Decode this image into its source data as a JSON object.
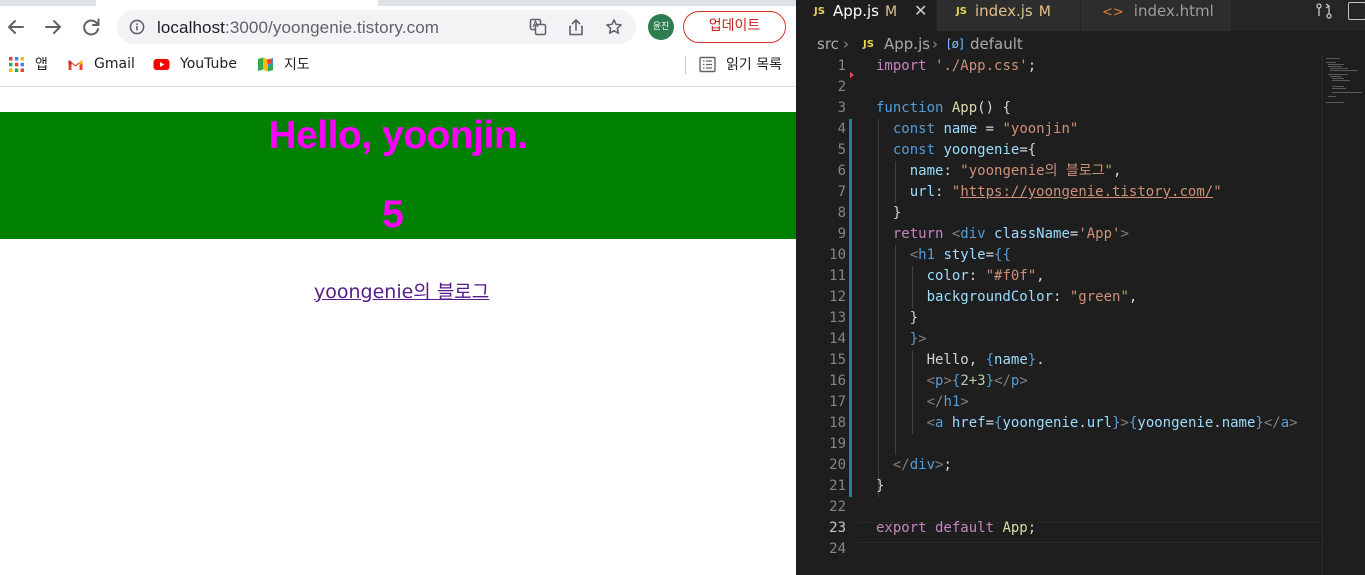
{
  "browser": {
    "url_host": "localhost",
    "url_rest": ":3000/yoongenie.tistory.com",
    "profile_label": "윤진",
    "update_label": "업데이트",
    "bookmarks": [
      {
        "label": "앱",
        "icon": "apps-grid-icon"
      },
      {
        "label": "Gmail",
        "icon": "gmail-icon"
      },
      {
        "label": "YouTube",
        "icon": "youtube-icon"
      },
      {
        "label": "지도",
        "icon": "maps-icon"
      }
    ],
    "reading_list": "읽기 목록"
  },
  "page": {
    "greeting": "Hello, yoonjin.",
    "calc_result": "5",
    "link_text": "yoongenie의 블로그",
    "h1_color": "#f0f",
    "h1_background": "green"
  },
  "editor": {
    "tabs": [
      {
        "label": "App.js",
        "badge": "M",
        "active": true
      },
      {
        "label": "index.js",
        "badge": "M",
        "active": false
      },
      {
        "label": "index.html",
        "active": false
      }
    ],
    "breadcrumbs": [
      "src",
      "App.js",
      "default"
    ],
    "line_numbers": [
      "1",
      "2",
      "3",
      "4",
      "5",
      "6",
      "7",
      "8",
      "9",
      "10",
      "11",
      "12",
      "13",
      "14",
      "15",
      "16",
      "17",
      "18",
      "19",
      "20",
      "21",
      "22",
      "23",
      "24"
    ],
    "code": {
      "l1_kw": "import",
      "l1_str": "'./App.css'",
      "l1_end": ";",
      "l3_kw": "function",
      "l3_name": "App",
      "l3_end": "() {",
      "l4_kw": "const",
      "l4_var": "name",
      "l4_eq": " = ",
      "l4_str": "\"yoonjin\"",
      "l5_kw": "const",
      "l5_var": "yoongenie",
      "l5_end": "={",
      "l6_key": "name",
      "l6_colon": ": ",
      "l6_str": "\"yoongenie의 블로그\"",
      "l6_end": ",",
      "l7_key": "url",
      "l7_colon": ": ",
      "l7_q1": "\"",
      "l7_url": "https://yoongenie.tistory.com/",
      "l7_q2": "\"",
      "l8": "}",
      "l9_kw": "return",
      "l9_open": " <",
      "l9_tag": "div",
      "l9_attr": " className",
      "l9_eq": "=",
      "l9_str": "'App'",
      "l9_close": ">",
      "l10_open": "<",
      "l10_tag": "h1",
      "l10_attr": " style",
      "l10_eq": "=",
      "l10_brace": "{{",
      "l11_key": "color",
      "l11_colon": ": ",
      "l11_str": "\"#f0f\"",
      "l11_end": ",",
      "l12_key": "backgroundColor",
      "l12_colon": ": ",
      "l12_str": "\"green\"",
      "l12_end": ",",
      "l13": "}",
      "l14_brace": "}",
      "l14_close": ">",
      "l15_text": "Hello, ",
      "l15_expr_open": "{",
      "l15_expr": "name",
      "l15_expr_close": "}",
      "l15_end": ".",
      "l16_open": "<",
      "l16_tag": "p",
      "l16_close": ">",
      "l16_brace1": "{",
      "l16_expr": "2+3",
      "l16_brace2": "}",
      "l16_end_open": "</",
      "l16_end_tag": "p",
      "l16_end_close": ">",
      "l17_open": "</",
      "l17_tag": "h1",
      "l17_close": ">",
      "l18_open": "<",
      "l18_tag": "a",
      "l18_attr": " href",
      "l18_eq": "=",
      "l18_b1": "{",
      "l18_obj1": "yoongenie",
      "l18_dot1": ".",
      "l18_prop1": "url",
      "l18_b2": "}",
      "l18_gt": ">",
      "l18_b3": "{",
      "l18_obj2": "yoongenie",
      "l18_dot2": ".",
      "l18_prop2": "name",
      "l18_b4": "}",
      "l18_end_open": "</",
      "l18_end_tag": "a",
      "l18_end_close": ">",
      "l20_open": "</",
      "l20_tag": "div",
      "l20_close": ">",
      "l20_end": ";",
      "l21": "}",
      "l23_kw": "export",
      "l23_kw2": " default",
      "l23_name": " App",
      "l23_end": ";"
    }
  }
}
